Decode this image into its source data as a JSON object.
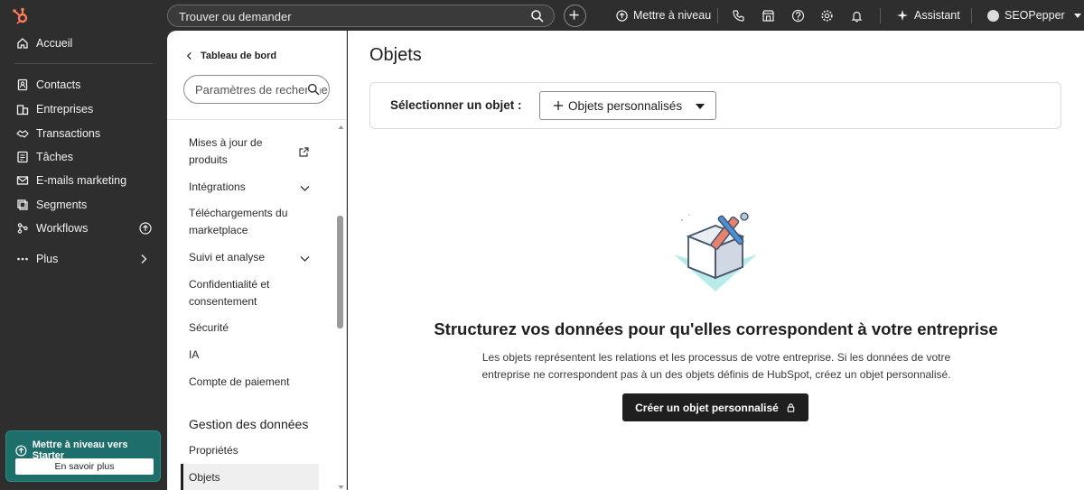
{
  "topbar": {
    "search_placeholder": "Trouver ou demander",
    "upgrade_label": "Mettre à niveau",
    "assistant_label": "Assistant",
    "account_name": "SEOPepper"
  },
  "leftnav": {
    "items": [
      {
        "label": "Accueil",
        "icon": "home-icon"
      },
      {
        "label": "Contacts",
        "icon": "contacts-icon"
      },
      {
        "label": "Entreprises",
        "icon": "companies-icon"
      },
      {
        "label": "Transactions",
        "icon": "deals-icon"
      },
      {
        "label": "Tâches",
        "icon": "tasks-icon"
      },
      {
        "label": "E-mails marketing",
        "icon": "email-icon"
      },
      {
        "label": "Segments",
        "icon": "segments-icon"
      },
      {
        "label": "Workflows",
        "icon": "workflows-icon"
      },
      {
        "label": "Plus",
        "icon": "more-icon"
      }
    ],
    "upgrade_card": {
      "title": "Mettre à niveau vers Starter",
      "button": "En savoir plus"
    }
  },
  "settings": {
    "back_label": "Tableau de bord",
    "search_placeholder": "Paramètres de recherche",
    "items": [
      {
        "label": "Mises à jour de produits"
      },
      {
        "label": "Intégrations"
      },
      {
        "label": "Téléchargements du marketplace"
      },
      {
        "label": "Suivi et analyse"
      },
      {
        "label": "Confidentialité et consentement"
      },
      {
        "label": "Sécurité"
      },
      {
        "label": "IA"
      },
      {
        "label": "Compte de paiement"
      }
    ],
    "section_heading": "Gestion des données",
    "section_items": [
      {
        "label": "Propriétés"
      },
      {
        "label": "Objets"
      }
    ]
  },
  "main": {
    "title": "Objets",
    "selector_label": "Sélectionner un objet :",
    "selector_value": "Objets personnalisés",
    "empty_title": "Structurez vos données pour qu'elles correspondent à votre entreprise",
    "empty_desc": "Les objets représentent les relations et les processus de votre entreprise. Si les données de votre entreprise ne correspondent pas à un des objets définis de HubSpot, créez un objet personnalisé.",
    "cta_label": "Créer un objet personnalisé"
  },
  "colors": {
    "nav_bg": "#2e2e2e",
    "accent_teal": "#1e6f6c",
    "cta_bg": "#1f1f1f"
  }
}
